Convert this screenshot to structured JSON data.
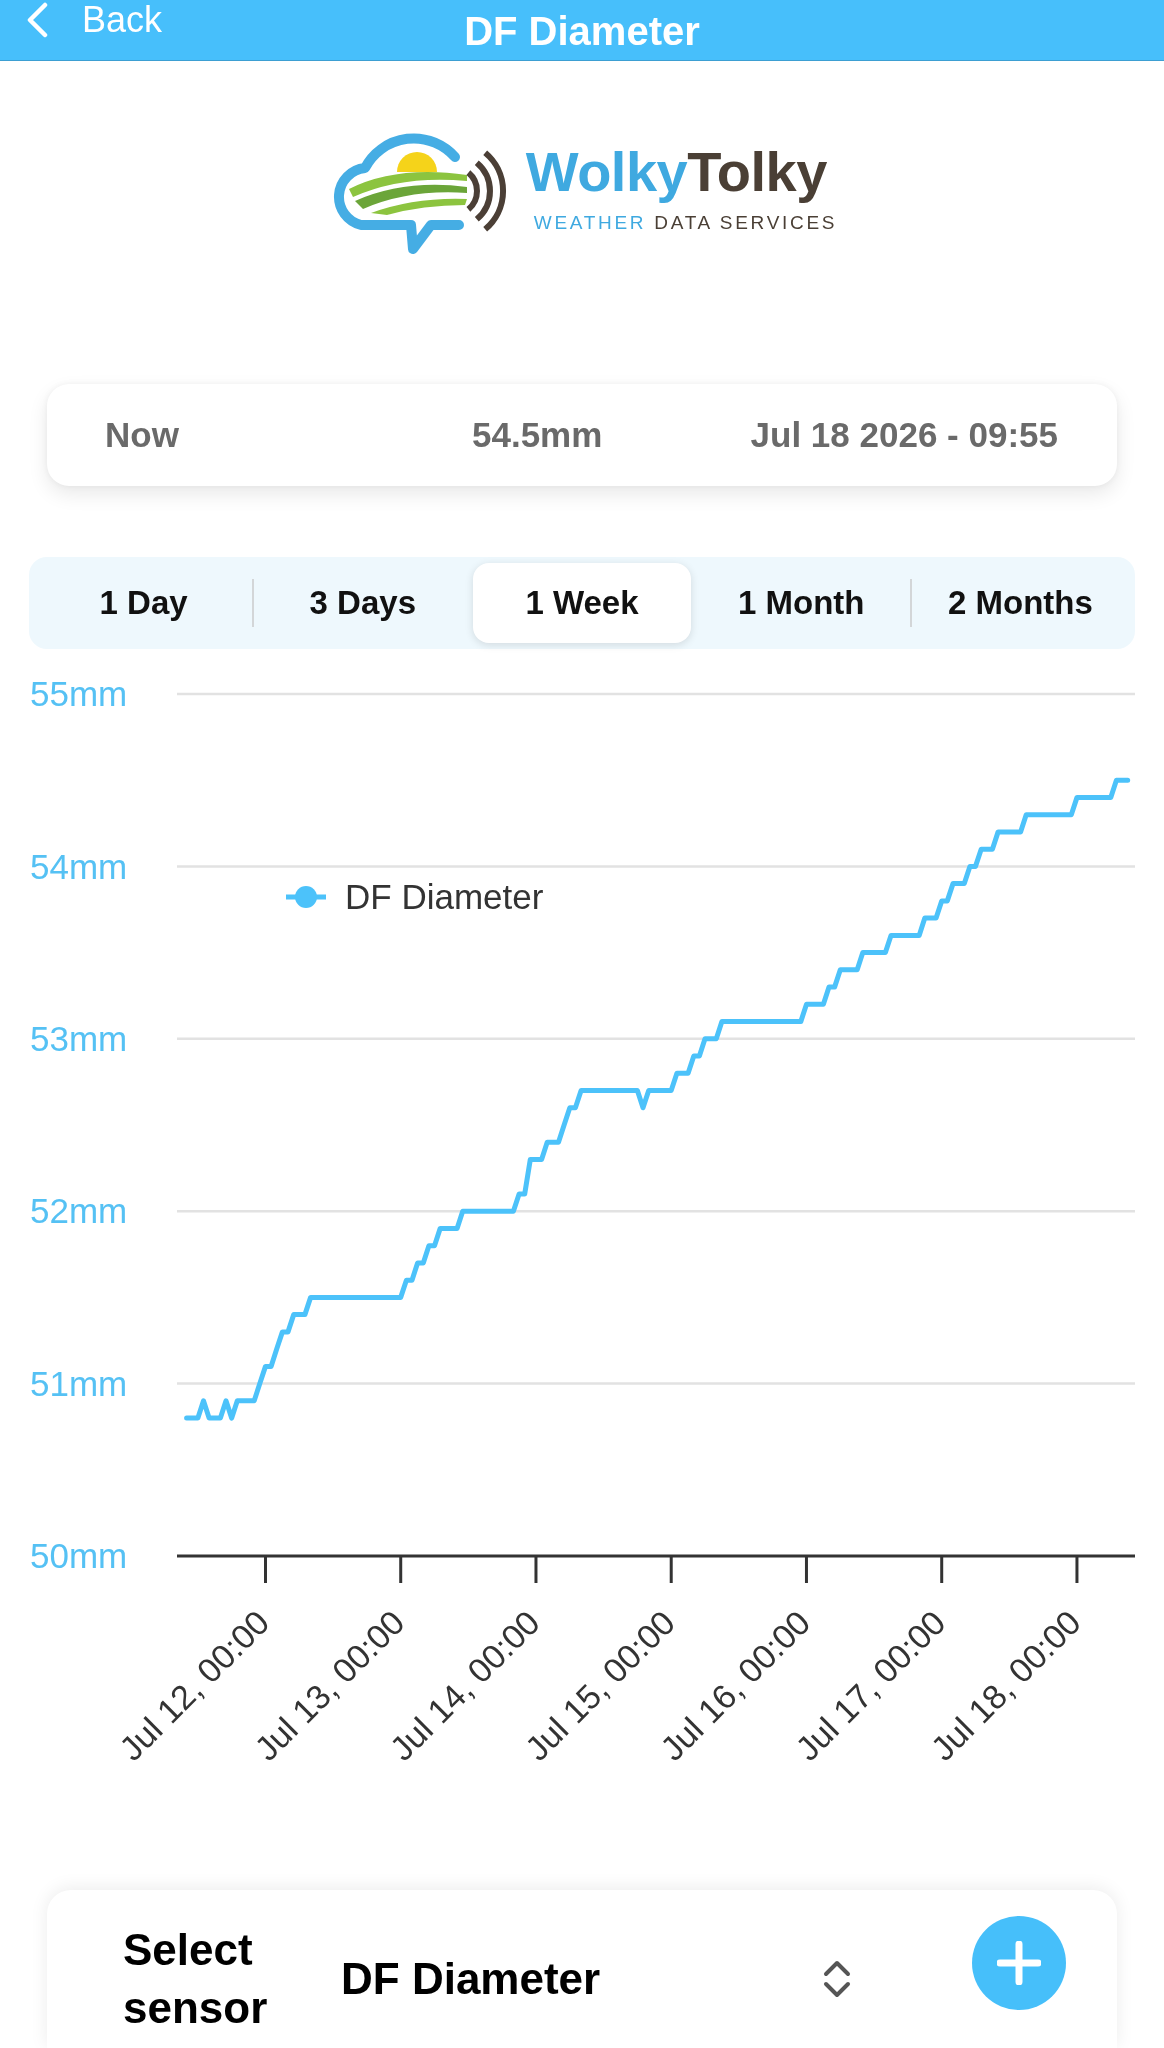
{
  "header": {
    "back_label": "Back",
    "title": "DF Diameter"
  },
  "logo": {
    "wordmark": [
      "Wolky",
      "Tolky"
    ],
    "tagline": [
      "WEATHER",
      "DATA SERVICES"
    ]
  },
  "current": {
    "label": "Now",
    "value": "54.5mm",
    "timestamp": "Jul 18 2026 - 09:55"
  },
  "range_tabs": [
    {
      "label": "1 Day",
      "selected": false
    },
    {
      "label": "3 Days",
      "selected": false
    },
    {
      "label": "1 Week",
      "selected": true
    },
    {
      "label": "1 Month",
      "selected": false
    },
    {
      "label": "2 Months",
      "selected": false
    }
  ],
  "chart": {
    "chart_data": {
      "type": "line",
      "grid": true,
      "categories": [
        null,
        null,
        null,
        null,
        null,
        null,
        null,
        null,
        null,
        null,
        null,
        null,
        null,
        null,
        "Jul 12, 00:00",
        null,
        null,
        null,
        null,
        null,
        null,
        null,
        null,
        null,
        null,
        null,
        null,
        null,
        null,
        null,
        null,
        null,
        null,
        null,
        null,
        null,
        null,
        null,
        "Jul 13, 00:00",
        null,
        null,
        null,
        null,
        null,
        null,
        null,
        null,
        null,
        null,
        null,
        null,
        null,
        null,
        null,
        null,
        null,
        null,
        null,
        null,
        null,
        null,
        null,
        "Jul 14, 00:00",
        null,
        null,
        null,
        null,
        null,
        null,
        null,
        null,
        null,
        null,
        null,
        null,
        null,
        null,
        null,
        null,
        null,
        null,
        null,
        null,
        null,
        null,
        null,
        "Jul 15, 00:00",
        null,
        null,
        null,
        null,
        null,
        null,
        null,
        null,
        null,
        null,
        null,
        null,
        null,
        null,
        null,
        null,
        null,
        null,
        null,
        null,
        null,
        null,
        null,
        "Jul 16, 00:00",
        null,
        null,
        null,
        null,
        null,
        null,
        null,
        null,
        null,
        null,
        null,
        null,
        null,
        null,
        null,
        null,
        null,
        null,
        null,
        null,
        null,
        null,
        null,
        "Jul 17, 00:00",
        null,
        null,
        null,
        null,
        null,
        null,
        null,
        null,
        null,
        null,
        null,
        null,
        null,
        null,
        null,
        null,
        null,
        null,
        null,
        null,
        null,
        null,
        null,
        "Jul 18, 00:00",
        null,
        null,
        null,
        null,
        null,
        null,
        null,
        null,
        null
      ],
      "series": [
        {
          "name": "DF Diameter",
          "color": "#4cc2fa",
          "values": [
            50.8,
            50.8,
            50.8,
            50.9,
            50.8,
            50.8,
            50.8,
            50.9,
            50.8,
            50.9,
            50.9,
            50.9,
            50.9,
            51.0,
            51.1,
            51.1,
            51.2,
            51.3,
            51.3,
            51.4,
            51.4,
            51.4,
            51.5,
            51.5,
            51.5,
            51.5,
            51.5,
            51.5,
            51.5,
            51.5,
            51.5,
            51.5,
            51.5,
            51.5,
            51.5,
            51.5,
            51.5,
            51.5,
            51.5,
            51.6,
            51.6,
            51.7,
            51.7,
            51.8,
            51.8,
            51.9,
            51.9,
            51.9,
            51.9,
            52.0,
            52.0,
            52.0,
            52.0,
            52.0,
            52.0,
            52.0,
            52.0,
            52.0,
            52.0,
            52.1,
            52.1,
            52.3,
            52.3,
            52.3,
            52.4,
            52.4,
            52.4,
            52.5,
            52.6,
            52.6,
            52.7,
            52.7,
            52.7,
            52.7,
            52.7,
            52.7,
            52.7,
            52.7,
            52.7,
            52.7,
            52.7,
            52.6,
            52.7,
            52.7,
            52.7,
            52.7,
            52.7,
            52.8,
            52.8,
            52.8,
            52.9,
            52.9,
            53.0,
            53.0,
            53.0,
            53.1,
            53.1,
            53.1,
            53.1,
            53.1,
            53.1,
            53.1,
            53.1,
            53.1,
            53.1,
            53.1,
            53.1,
            53.1,
            53.1,
            53.1,
            53.2,
            53.2,
            53.2,
            53.2,
            53.3,
            53.3,
            53.4,
            53.4,
            53.4,
            53.4,
            53.5,
            53.5,
            53.5,
            53.5,
            53.5,
            53.6,
            53.6,
            53.6,
            53.6,
            53.6,
            53.6,
            53.7,
            53.7,
            53.7,
            53.8,
            53.8,
            53.9,
            53.9,
            53.9,
            54.0,
            54.0,
            54.1,
            54.1,
            54.1,
            54.2,
            54.2,
            54.2,
            54.2,
            54.2,
            54.3,
            54.3,
            54.3,
            54.3,
            54.3,
            54.3,
            54.3,
            54.3,
            54.3,
            54.4,
            54.4,
            54.4,
            54.4,
            54.4,
            54.4,
            54.4,
            54.5,
            54.5,
            54.5
          ]
        }
      ],
      "ylim": [
        50,
        55
      ],
      "yticks": [
        {
          "value": 55,
          "label": "55mm"
        },
        {
          "value": 54,
          "label": "54mm"
        },
        {
          "value": 53,
          "label": "53mm"
        },
        {
          "value": 52,
          "label": "52mm"
        },
        {
          "value": 51,
          "label": "51mm"
        },
        {
          "value": 50,
          "label": "50mm"
        }
      ]
    }
  },
  "sensor_select": {
    "label": "Select sensor",
    "value": "DF Diameter"
  }
}
